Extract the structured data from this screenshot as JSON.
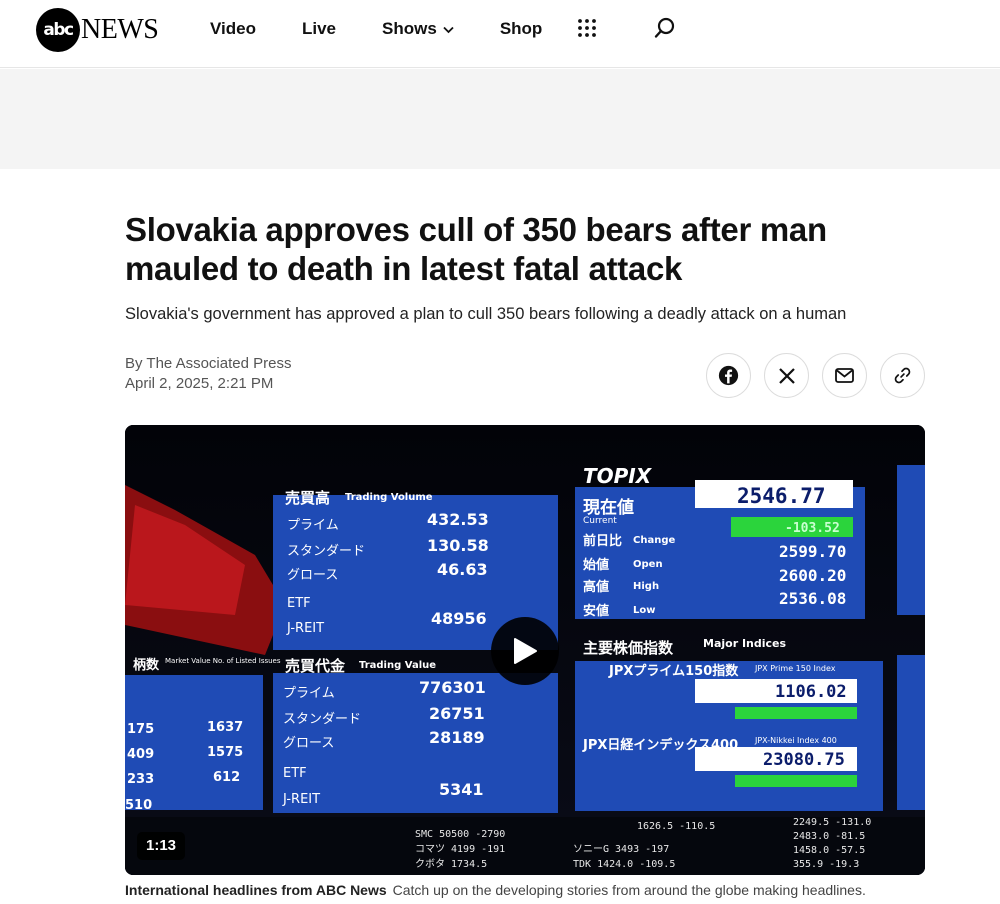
{
  "header": {
    "logo_circle": "abc",
    "logo_word": "NEWS",
    "nav": [
      "Video",
      "Live",
      "Shows",
      "Shop"
    ],
    "icons": {
      "shows_dropdown": "chevron-down-icon",
      "menu": "grid-dots-icon",
      "search": "search-icon"
    }
  },
  "article": {
    "headline": "Slovakia approves cull of 350 bears after man mauled to death in latest fatal attack",
    "subhead": "Slovakia's government has approved a plan to cull 350 bears following a deadly attack on a human",
    "byline": "By The Associated Press",
    "date": "April 2, 2025, 2:21 PM",
    "share": [
      "facebook-icon",
      "x-icon",
      "email-icon",
      "link-icon"
    ]
  },
  "video": {
    "duration": "1:13",
    "caption_title": "International headlines from ABC News",
    "caption_text": "Catch up on the developing stories from around the globe making headlines.",
    "board": {
      "brand": "TOPIX",
      "current_label": "現在値",
      "current_label_en": "Current",
      "current_value": "2546.77",
      "change_label": "前日比",
      "change_label_en": "Change",
      "change_value": "-103.52",
      "open_label": "始値",
      "open_label_en": "Open",
      "open_value": "2599.70",
      "high_label": "高値",
      "high_label_en": "High",
      "high_value": "2600.20",
      "low_label": "安値",
      "low_label_en": "Low",
      "low_value": "2536.08",
      "volume_title": "売買高",
      "volume_title_en": "Trading Volume",
      "volume_rows": [
        {
          "label": "プライム",
          "sub": "Prime",
          "value": "432.53"
        },
        {
          "label": "スタンダード",
          "sub": "Standard",
          "value": "130.58"
        },
        {
          "label": "グロース",
          "sub": "Growth",
          "value": "46.63"
        },
        {
          "label": "ETF",
          "sub": "",
          "value": ""
        },
        {
          "label": "J-REIT",
          "sub": "",
          "value": "48956"
        }
      ],
      "value_title": "売買代金",
      "value_title_en": "Trading Value",
      "value_rows": [
        {
          "label": "プライム",
          "sub": "Prime",
          "value": "776301"
        },
        {
          "label": "スタンダード",
          "sub": "Standard",
          "value": "26751"
        },
        {
          "label": "グロース",
          "sub": "Growth",
          "value": "28189"
        },
        {
          "label": "ETF",
          "sub": "",
          "value": ""
        },
        {
          "label": "J-REIT",
          "sub": "",
          "value": "5341"
        }
      ],
      "indices_title": "主要株価指数",
      "indices_title_en": "Major Indices",
      "idx1_name": "JPXプライム150指数",
      "idx1_en": "JPX Prime 150 Index",
      "idx1_value": "1106.02",
      "idx2_name": "JPX日経インデックス400",
      "idx2_en": "JPX-Nikkei Index 400",
      "idx2_value": "23080.75",
      "left_title": "柄数",
      "left_title_en": "Market Value No. of Listed Issues",
      "left_rows": [
        {
          "a": "175",
          "b": "1637"
        },
        {
          "a": "409",
          "b": "1575"
        },
        {
          "a": "233",
          "b": "612"
        },
        {
          "a": "510",
          "b": ""
        }
      ],
      "ticker": [
        "SMC 50500 -2790",
        "コマツ 4199 -191",
        "クボタ 1734.5",
        "ソニーG 3493 -197",
        "TDK 1424.0 -109.5",
        "1626.5 -110.5",
        "2249.5 -131.0",
        "2483.0 -81.5",
        "1458.0 -57.5",
        "355.9 -19.3"
      ]
    }
  }
}
